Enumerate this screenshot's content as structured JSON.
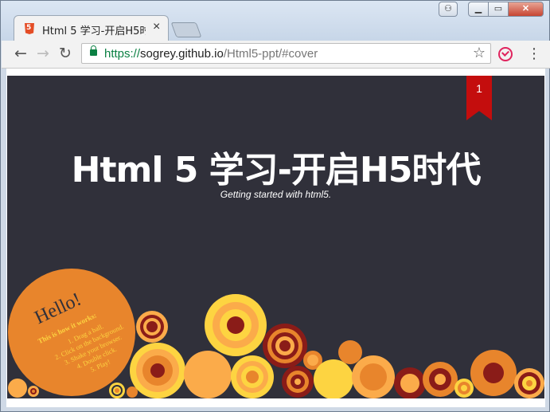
{
  "window": {
    "tab_title": "Html 5 学习-开启H5时代",
    "tab_favicon": "html5-favicon-icon",
    "tab_close": "×",
    "user_btn": "⚇",
    "min_btn": "▁",
    "max_btn": "▭",
    "close_btn": "✕"
  },
  "toolbar": {
    "back": "←",
    "forward": "→",
    "reload": "↻",
    "url_scheme": "https://",
    "url_host": "sogrey.github.io",
    "url_path": "/Html5-ppt/#cover",
    "star": "☆",
    "menu": "⋮"
  },
  "slide": {
    "page_number": "1",
    "title": "Html 5 学习-开启H5时代",
    "subtitle": "Getting started with html5."
  },
  "hello_ball": {
    "heading": "Hello!",
    "intro": "This is how it works:",
    "steps": [
      "1. Drag a ball.",
      "2. Click on the background.",
      "3. Shake your browser.",
      "4. Double click.",
      "5. Play!"
    ]
  },
  "colors": {
    "slide_bg": "#30303a",
    "ribbon": "#c40d0d",
    "ball_orange": "#e8852c",
    "ball_yellow": "#fdd441",
    "ball_dark_red": "#8a1c18",
    "ball_light_orange": "#fbab4a"
  }
}
